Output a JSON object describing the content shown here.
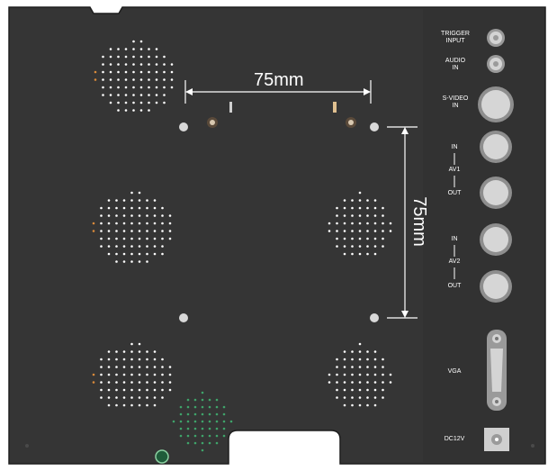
{
  "colors": {
    "panel": "#353535",
    "panel_edge": "#1e1e1e",
    "vent_dot": "#ffffff",
    "vent_dot_orange": "#d98a3a",
    "vent_dot_green": "#3fa46a",
    "connector_ring": "#c9c9c9",
    "dimension_line": "#ffffff"
  },
  "dimensions": {
    "horizontal": "75mm",
    "vertical": "75mm"
  },
  "ports": [
    {
      "id": "trigger",
      "label": "TRIGGER\nINPUT",
      "icon": "small-round-jack-icon"
    },
    {
      "id": "audio",
      "label": "AUDIO\nIN",
      "icon": "small-round-jack-icon"
    },
    {
      "id": "svideo",
      "label": "S-VIDEO\nIN",
      "icon": "round-connector-icon"
    },
    {
      "id": "av1",
      "group": "AV1",
      "in": "IN",
      "out": "OUT",
      "icon": "bnc-connector-icon"
    },
    {
      "id": "av2",
      "group": "AV2",
      "in": "IN",
      "out": "OUT",
      "icon": "bnc-connector-icon"
    },
    {
      "id": "vga",
      "label": "VGA",
      "icon": "dsub-connector-icon"
    },
    {
      "id": "dc",
      "label": "DC12V",
      "icon": "dc-jack-icon"
    }
  ]
}
